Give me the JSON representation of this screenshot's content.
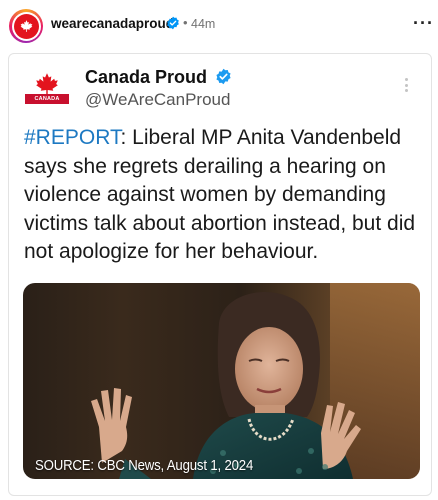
{
  "post": {
    "username": "wearecanadaproud",
    "separator": "•",
    "time": "44m",
    "more": "···"
  },
  "tweet": {
    "display_name": "Canada Proud",
    "handle": "@WeAreCanProud",
    "logo_banner": "CANADA PROUD",
    "hashtag": "#REPORT",
    "body": ": Liberal MP Anita Vandenbeld says she regrets derailing a hearing on violence against women by demanding victims talk about abortion instead, but did not apologize for her behaviour.",
    "media_caption": "SOURCE: CBC News, August 1, 2024"
  },
  "colors": {
    "brand_red": "#e3141e",
    "verified_blue": "#0095f6",
    "hashtag_blue": "#1d79c2"
  },
  "icons": [
    "verified-badge-icon",
    "more-options-icon",
    "maple-leaf-icon"
  ]
}
